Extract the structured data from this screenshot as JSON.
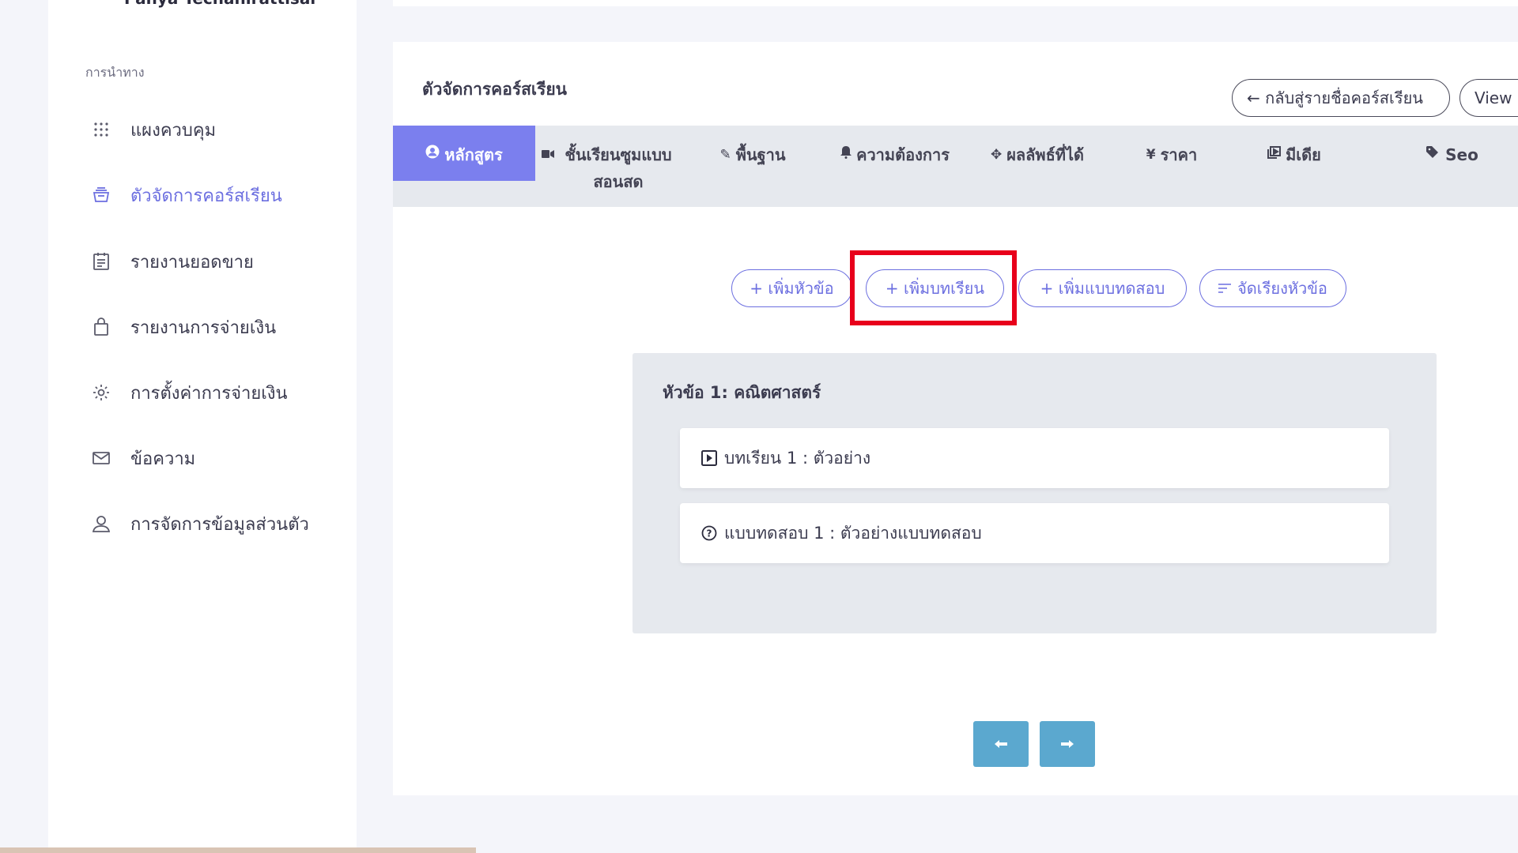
{
  "sidebar": {
    "user_name": "Panya Techahirattisai",
    "nav_heading": "การนำทาง",
    "items": [
      {
        "label": "แผงควบคุม",
        "icon": "grid-icon",
        "active": false
      },
      {
        "label": "ตัวจัดการคอร์สเรียน",
        "icon": "course-stack-icon",
        "active": true
      },
      {
        "label": "รายงานยอดขาย",
        "icon": "report-icon",
        "active": false
      },
      {
        "label": "รายงานการจ่ายเงิน",
        "icon": "bag-icon",
        "active": false
      },
      {
        "label": "การตั้งค่าการจ่ายเงิน",
        "icon": "gear-icon",
        "active": false
      },
      {
        "label": "ข้อความ",
        "icon": "mail-icon",
        "active": false
      },
      {
        "label": "การจัดการข้อมูลส่วนตัว",
        "icon": "user-icon",
        "active": false
      }
    ]
  },
  "card": {
    "title": "ตัวจัดการคอร์สเรียน",
    "back_button": "← กลับสู่รายชื่อคอร์สเรียน",
    "view_button": "View"
  },
  "tabs": [
    {
      "label": "หลักสูตร",
      "icon": "user-circle-icon",
      "active": true
    },
    {
      "label": "ชั้นเรียนซูมแบบ สอนสด",
      "icon": "video-icon",
      "active": false
    },
    {
      "label": "พื้นฐาน",
      "icon": "pencil-icon",
      "active": false
    },
    {
      "label": "ความต้องการ",
      "icon": "bell-icon",
      "active": false
    },
    {
      "label": "ผลลัพธ์ที่ได้",
      "icon": "move-icon",
      "active": false
    },
    {
      "label": "ราคา",
      "icon": "yen-icon",
      "active": false
    },
    {
      "label": "มีเดีย",
      "icon": "media-icon",
      "active": false
    },
    {
      "label": "Seo",
      "icon": "tag-icon",
      "active": false
    }
  ],
  "actions": {
    "add_section": "+ เพิ่มหัวข้อ",
    "add_lesson": "+ เพิ่มบทเรียน",
    "add_quiz": "+ เพิ่มแบบทดสอบ",
    "sort_sections": "จัดเรียงหัวข้อ"
  },
  "section": {
    "title": "หัวข้อ 1: คณิตศาสตร์",
    "items": [
      {
        "label": "บทเรียน 1 : ตัวอย่าง",
        "icon": "play-square-icon"
      },
      {
        "label": "แบบทดสอบ 1 : ตัวอย่างแบบทดสอบ",
        "icon": "question-circle-icon"
      }
    ]
  },
  "pager": {
    "prev_icon": "arrow-left-icon",
    "next_icon": "arrow-right-icon"
  },
  "colors": {
    "accent": "#6c6fe0",
    "active_tab": "#7b7fee",
    "highlight": "#e8001b",
    "pager": "#5ba8cf"
  }
}
